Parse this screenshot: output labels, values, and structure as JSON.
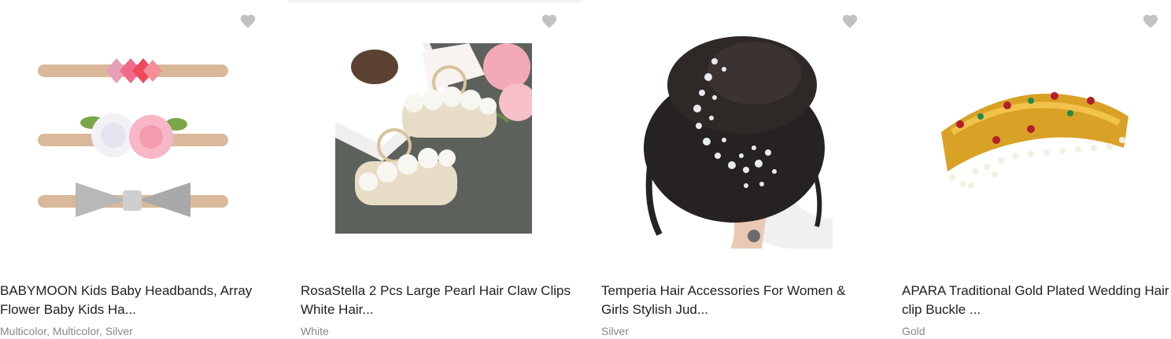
{
  "products": [
    {
      "title_line1": "BABYMOON Kids Baby Headbands, Array",
      "title_line2": "Flower Baby Kids Ha...",
      "variants": "Multicolor, Multicolor, Silver",
      "image_icon": "headbands-image",
      "wishlist_icon": "heart-icon"
    },
    {
      "title_line1": "RosaStella 2 Pcs Large Pearl Hair Claw Clips",
      "title_line2": "White Hair...",
      "variants": "White",
      "image_icon": "pearl-claw-clips-image",
      "wishlist_icon": "heart-icon"
    },
    {
      "title_line1": "Temperia Hair Accessories For Women &",
      "title_line2": "Girls Stylish Jud...",
      "variants": "Silver",
      "image_icon": "hair-bun-pin-image",
      "wishlist_icon": "heart-icon"
    },
    {
      "title_line1": "APARA Traditional Gold Plated Wedding Hair",
      "title_line2": "clip Buckle ...",
      "variants": "Gold",
      "image_icon": "gold-hair-clip-image",
      "wishlist_icon": "heart-icon"
    }
  ],
  "colors": {
    "title": "#212121",
    "variant": "#878787",
    "heart": "#c2c2c2"
  }
}
